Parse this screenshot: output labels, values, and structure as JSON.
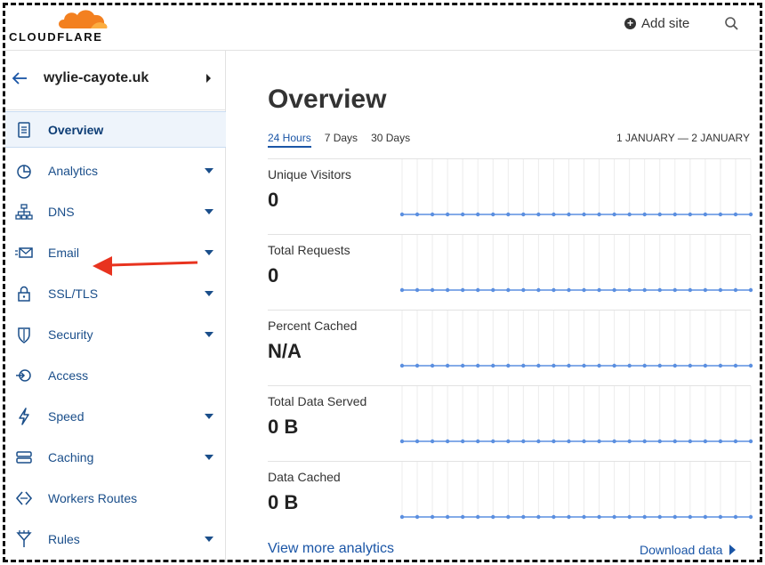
{
  "brand": {
    "name": "CLOUDFLARE",
    "logo_color": "#f38020"
  },
  "header": {
    "add_site_label": "Add site",
    "add_icon": "plus-circle-icon",
    "search_icon": "search-icon"
  },
  "zone": {
    "name": "wylie-cayote.uk"
  },
  "nav": [
    {
      "label": "Overview",
      "icon": "clipboard-icon",
      "active": true,
      "has_caret": false
    },
    {
      "label": "Analytics",
      "icon": "pie-chart-icon",
      "has_caret": true
    },
    {
      "label": "DNS",
      "icon": "network-icon",
      "has_caret": true
    },
    {
      "label": "Email",
      "icon": "envelope-icon",
      "has_caret": true
    },
    {
      "label": "SSL/TLS",
      "icon": "lock-icon",
      "has_caret": true
    },
    {
      "label": "Security",
      "icon": "shield-icon",
      "has_caret": true
    },
    {
      "label": "Access",
      "icon": "access-icon",
      "has_caret": false
    },
    {
      "label": "Speed",
      "icon": "lightning-icon",
      "has_caret": true
    },
    {
      "label": "Caching",
      "icon": "storage-icon",
      "has_caret": true
    },
    {
      "label": "Workers Routes",
      "icon": "workers-icon",
      "has_caret": false
    },
    {
      "label": "Rules",
      "icon": "rules-icon",
      "has_caret": true
    }
  ],
  "annotation": {
    "arrow_color": "#e8331f",
    "points_to": "DNS"
  },
  "main": {
    "title": "Overview",
    "range_tabs": [
      {
        "label": "24 Hours",
        "selected": true
      },
      {
        "label": "7 Days"
      },
      {
        "label": "30 Days"
      }
    ],
    "date_range": "1 JANUARY — 2 JANUARY",
    "metrics": [
      {
        "label": "Unique Visitors",
        "value": "0"
      },
      {
        "label": "Total Requests",
        "value": "0"
      },
      {
        "label": "Percent Cached",
        "value": "N/A"
      },
      {
        "label": "Total Data Served",
        "value": "0 B"
      },
      {
        "label": "Data Cached",
        "value": "0 B"
      }
    ],
    "spark_point_count": 24,
    "spark_color": "#5b8fe0",
    "view_more_label": "View more analytics",
    "download_label": "Download data"
  }
}
